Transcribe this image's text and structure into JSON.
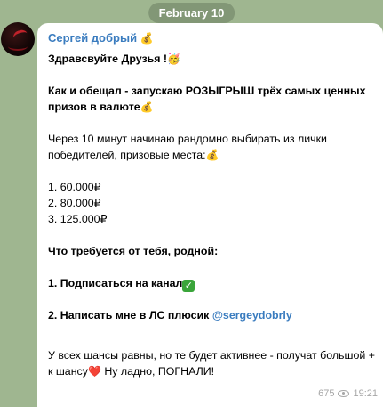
{
  "date_label": "February 10",
  "message": {
    "sender": "Сергей добрый",
    "sender_emoji": "💰",
    "greeting": "Здравсвуйте Друзья !",
    "greeting_emoji": "🥳",
    "announce_line1": "Как и обещал - запускаю РОЗЫГРЫШ трёх самых ценных",
    "announce_line2": "призов в валюте",
    "announce_emoji": "💰",
    "info_line1": "Через 10 минут начинаю рандомно выбирать из лички",
    "info_line2": "победителей, призовые места:",
    "info_emoji": "💰",
    "prize_1": "1. 60.000₽",
    "prize_2": "2. 80.000₽",
    "prize_3": "3. 125.000₽",
    "requirements_title": "Что требуется от тебя, родной:",
    "step_1": "1. Подписаться на канал",
    "step_1_emoji": "✓",
    "step_2_prefix": "2. Написать мне в ЛС плюсик ",
    "step_2_mention": "@sergeydobrly",
    "closing_line1": "У всех шансы равны, но те будет активнее - получат большой +",
    "closing_line2a": "к шансу",
    "closing_emoji": "❤️",
    "closing_line2b": " Ну ладно, ПОГНАЛИ!",
    "views": "675",
    "time": "19:21"
  }
}
